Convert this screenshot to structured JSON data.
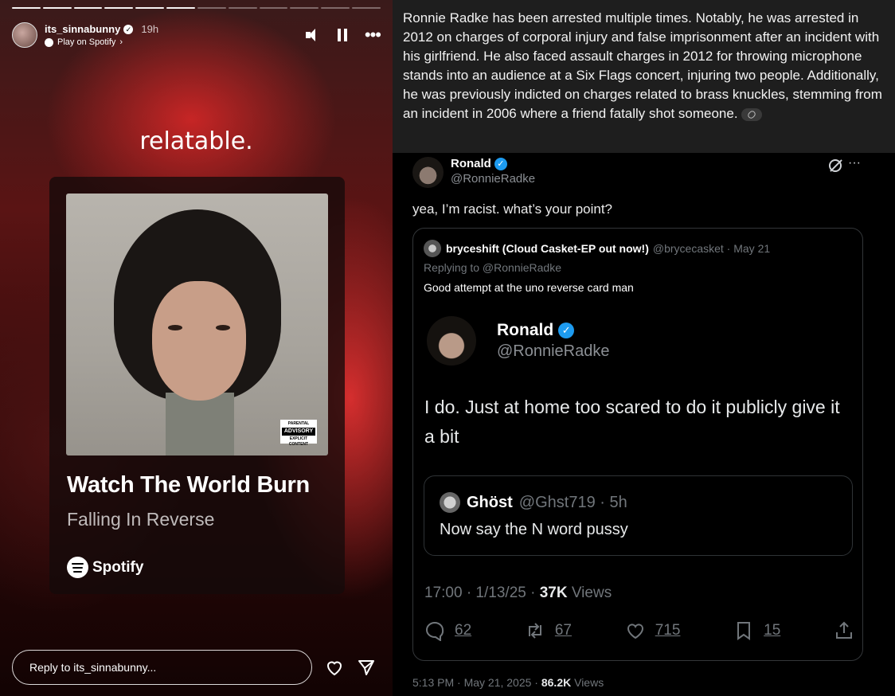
{
  "story": {
    "username": "its_sinnabunny",
    "time": "19h",
    "subtitle": "Play on Spotify",
    "caption": "relatable.",
    "song": {
      "title": "Watch The World Burn",
      "artist": "Falling In Reverse",
      "brand": "Spotify",
      "advisory_top": "PARENTAL",
      "advisory_mid": "ADVISORY",
      "advisory_bottom": "EXPLICIT CONTENT"
    },
    "reply_placeholder": "Reply to its_sinnabunny...",
    "progress": {
      "total": 12,
      "done": 6
    }
  },
  "grok": {
    "text": "Ronnie Radke has been arrested multiple times. Notably, he was arrested in 2012 on charges of corporal injury and false imprisonment after an incident with his girlfriend. He also faced assault charges in 2012 for throwing microphone stands into an audience at a Six Flags concert, injuring two people. Additionally, he was previously indicted on charges related to brass knuckles, stemming from an incident in 2006 where a friend fatally shot someone."
  },
  "tweet": {
    "name": "Ronald",
    "handle": "@RonnieRadke",
    "text": "yea, I’m racist. what’s your point?",
    "footer_time": "5:13 PM · May 21, 2025 · ",
    "footer_views": "86.2K",
    "footer_views_label": " Views"
  },
  "quote": {
    "name": "bryceshift (Cloud Casket-EP out now!)",
    "handle": "@brycecasket · May 21",
    "replying": "Replying to @RonnieRadke",
    "text": "Good attempt at the uno reverse card man",
    "inner": {
      "name": "Ronald",
      "handle": "@RonnieRadke",
      "text": "I do. Just at home too scared to do it publicly give it a bit",
      "meta_time": "17:00 · 1/13/25 · ",
      "meta_views": "37K",
      "meta_views_label": " Views",
      "nested": {
        "name": "Ghöst",
        "handle": "@Ghst719 · 5h",
        "text": "Now say the N word pussy"
      },
      "stats": {
        "replies": "62",
        "reposts": "67",
        "likes": "715",
        "bookmarks": "15"
      }
    }
  }
}
